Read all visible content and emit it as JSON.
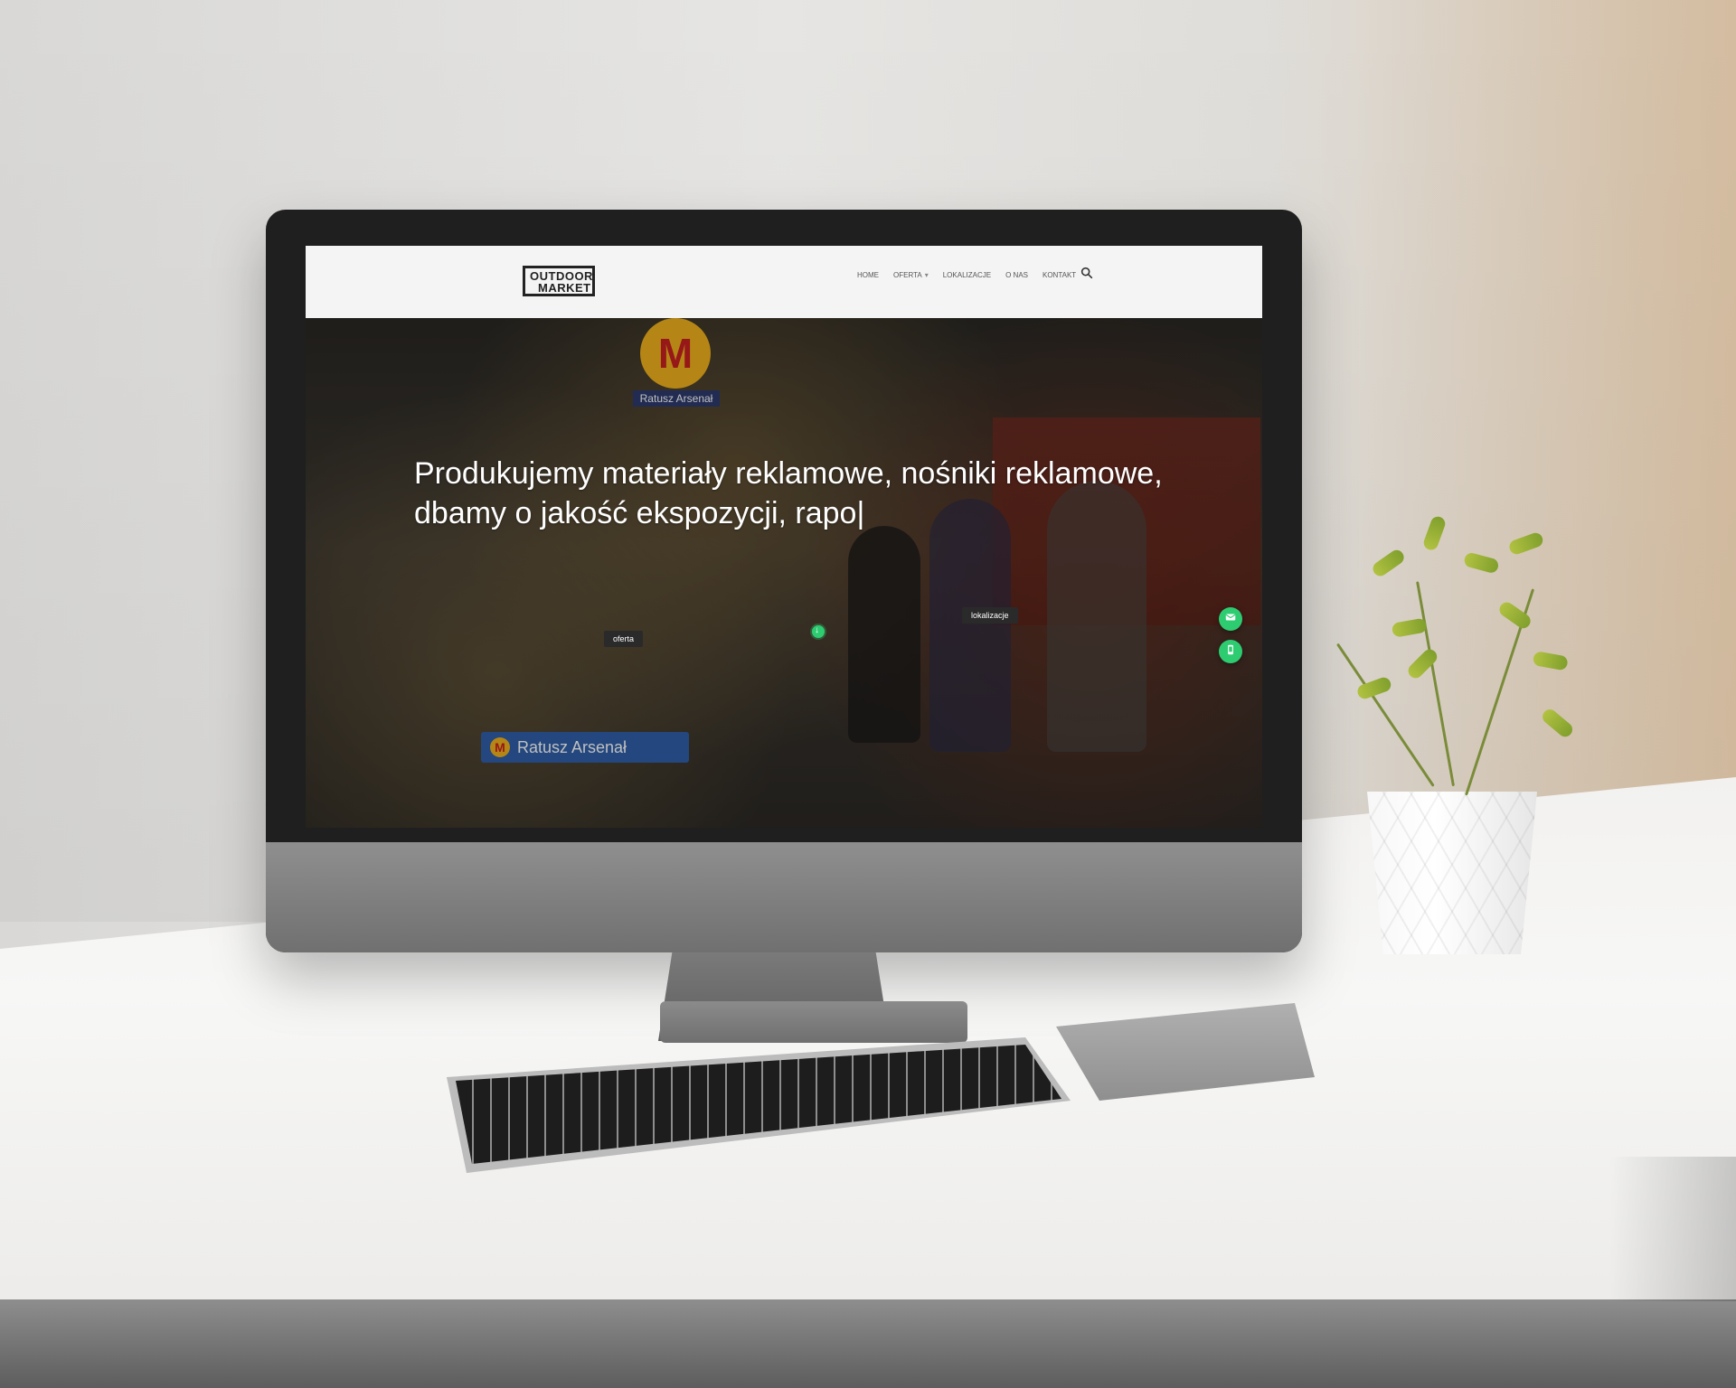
{
  "site": {
    "logo": {
      "line1": "OUTDOOR",
      "line2": "MARKET"
    },
    "nav": [
      {
        "label": "HOME"
      },
      {
        "label": "OFERTA",
        "has_dropdown": true
      },
      {
        "label": "LOKALIZACJE"
      },
      {
        "label": "O NAS"
      },
      {
        "label": "KONTAKT"
      }
    ],
    "search_icon": "search-icon",
    "hero": {
      "headline": "Produkujemy materiały reklamowe, nośniki reklamowe, dbamy o jakość ekspozycji, rapo|",
      "tags": {
        "oferta": "oferta",
        "lokalizacje": "lokalizacje"
      },
      "signs": {
        "metro_letter": "M",
        "station_top": "Ratusz Arsenał",
        "station_bottom": "Ratusz Arsenał"
      }
    },
    "floating_actions": [
      {
        "icon": "mail-icon"
      },
      {
        "icon": "phone-icon"
      }
    ],
    "accent_color": "#2ecc71"
  }
}
